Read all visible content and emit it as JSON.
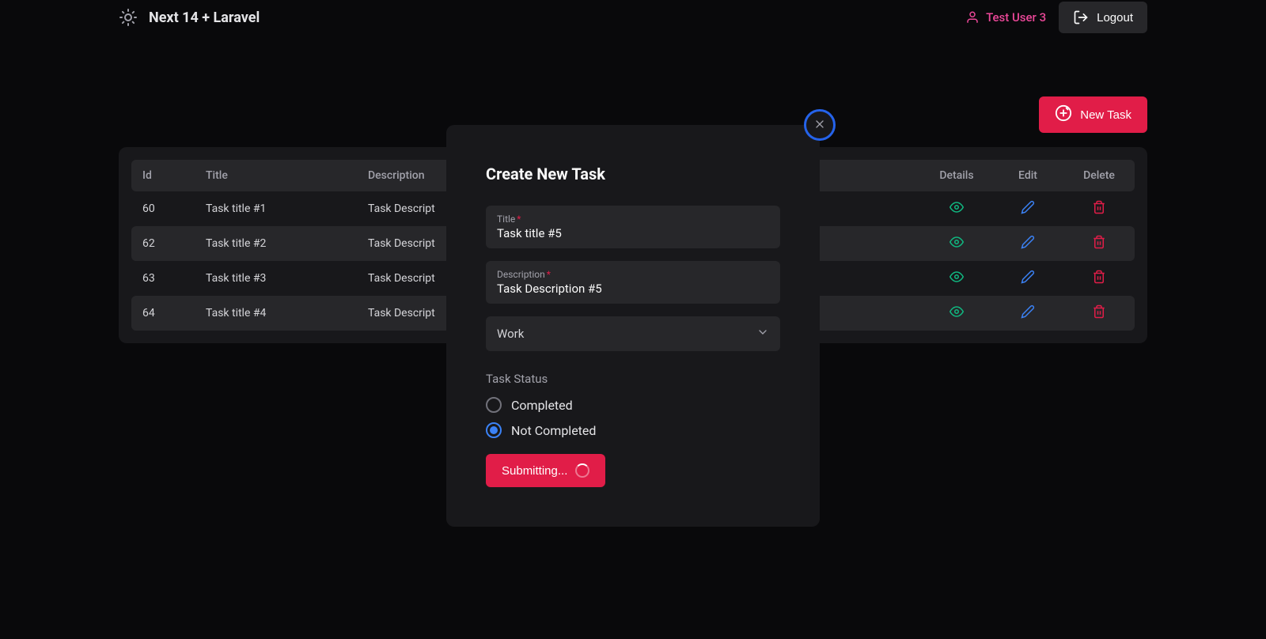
{
  "header": {
    "app_title": "Next 14 + Laravel",
    "user_name": "Test User 3",
    "logout_label": "Logout"
  },
  "toolbar": {
    "new_task_label": "New Task"
  },
  "table": {
    "columns": {
      "id": "Id",
      "title": "Title",
      "description": "Description",
      "details": "Details",
      "edit": "Edit",
      "delete": "Delete"
    },
    "rows": [
      {
        "id": "60",
        "title": "Task title #1",
        "description": "Task Descript"
      },
      {
        "id": "62",
        "title": "Task title #2",
        "description": "Task Descript"
      },
      {
        "id": "63",
        "title": "Task title #3",
        "description": "Task Descript"
      },
      {
        "id": "64",
        "title": "Task title #4",
        "description": "Task Descript"
      }
    ]
  },
  "modal": {
    "title": "Create New Task",
    "fields": {
      "title_label": "Title",
      "title_value": "Task title #5",
      "description_label": "Description",
      "description_value": "Task Description #5",
      "required_mark": "*"
    },
    "select_value": "Work",
    "status_heading": "Task Status",
    "status_options": {
      "completed": "Completed",
      "not_completed": "Not Completed"
    },
    "status_selected": "not_completed",
    "submit_label": "Submitting..."
  },
  "icons": {
    "sun": "sun-icon",
    "user": "user-icon",
    "logout": "logout-icon",
    "add": "add-circle-icon",
    "eye": "eye-icon",
    "pencil": "pencil-icon",
    "trash": "trash-icon",
    "close": "close-icon",
    "chevron_down": "chevron-down-icon"
  },
  "colors": {
    "accent": "#e11d48",
    "link_blue": "#3b82f6",
    "success_green": "#10b981",
    "bg": "#09090b",
    "panel": "#18181b",
    "surface": "#27272a"
  }
}
